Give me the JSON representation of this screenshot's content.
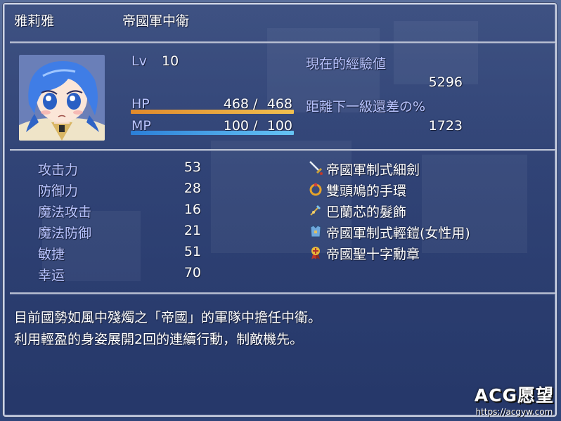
{
  "header": {
    "name": "雅莉雅",
    "class": "帝國軍中衛"
  },
  "status": {
    "level_label": "Lv",
    "level": "10",
    "hp_label": "HP",
    "hp_current": "468",
    "hp_max": "468",
    "hp_fill": 1.0,
    "mp_label": "MP",
    "mp_current": "100",
    "mp_max": "100",
    "mp_fill": 1.0,
    "slash": "/",
    "exp_label": "現在的經驗値",
    "exp_value": "5296",
    "next_label": "距離下一級還差の%",
    "next_value": "1723"
  },
  "params": [
    {
      "label": "攻击力",
      "value": "53"
    },
    {
      "label": "防御力",
      "value": "28"
    },
    {
      "label": "魔法攻击",
      "value": "16"
    },
    {
      "label": "魔法防御",
      "value": "21"
    },
    {
      "label": "敏捷",
      "value": "51"
    },
    {
      "label": "幸运",
      "value": "70"
    }
  ],
  "equipment": [
    {
      "name": "帝國軍制式細劍",
      "icon": "sword-icon"
    },
    {
      "name": "雙頭鳩的手環",
      "icon": "ring-icon"
    },
    {
      "name": "巴蘭芯的髮飾",
      "icon": "hair-ornament-icon"
    },
    {
      "name": "帝國軍制式輕鎧(女性用)",
      "icon": "armor-icon"
    },
    {
      "name": "帝國聖十字勳章",
      "icon": "medal-icon"
    }
  ],
  "profile": {
    "line1": "目前國勢如風中殘燭之「帝國」的軍隊中擔任中衛。",
    "line2": "利用輕盈的身姿展開2回的連續行動，制敵機先。"
  },
  "watermark": {
    "title": "ACG愿望",
    "url": "https://acgyw.com"
  },
  "colors": {
    "system_text": "#b9c4ff",
    "hp_gauge_start": "#e08a2c",
    "hp_gauge_end": "#f0c050",
    "mp_gauge_start": "#2b7fd8",
    "mp_gauge_end": "#66c4f4"
  }
}
